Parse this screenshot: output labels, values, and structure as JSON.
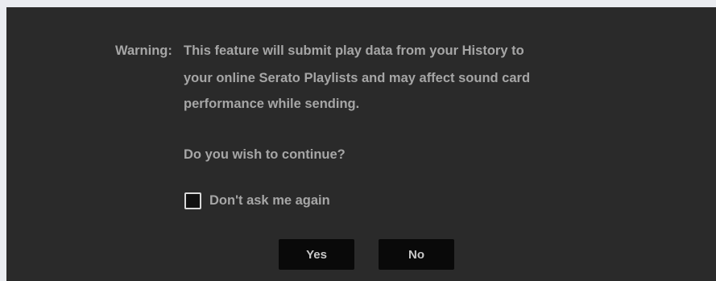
{
  "dialog": {
    "warning_label": "Warning:",
    "warning_lines": [
      "This feature will submit play data from your History to",
      "your online Serato Playlists and may affect sound card",
      "performance while sending."
    ],
    "question": "Do you wish to continue?",
    "checkbox": {
      "label": "Don't ask me again",
      "checked": false
    },
    "buttons": {
      "yes": "Yes",
      "no": "No"
    }
  },
  "colors": {
    "page_background": "#eaecf0",
    "dialog_background": "#2a2a2a",
    "text": "#a6a6a6",
    "button_background": "#090909",
    "button_text": "#c8c8c8"
  }
}
